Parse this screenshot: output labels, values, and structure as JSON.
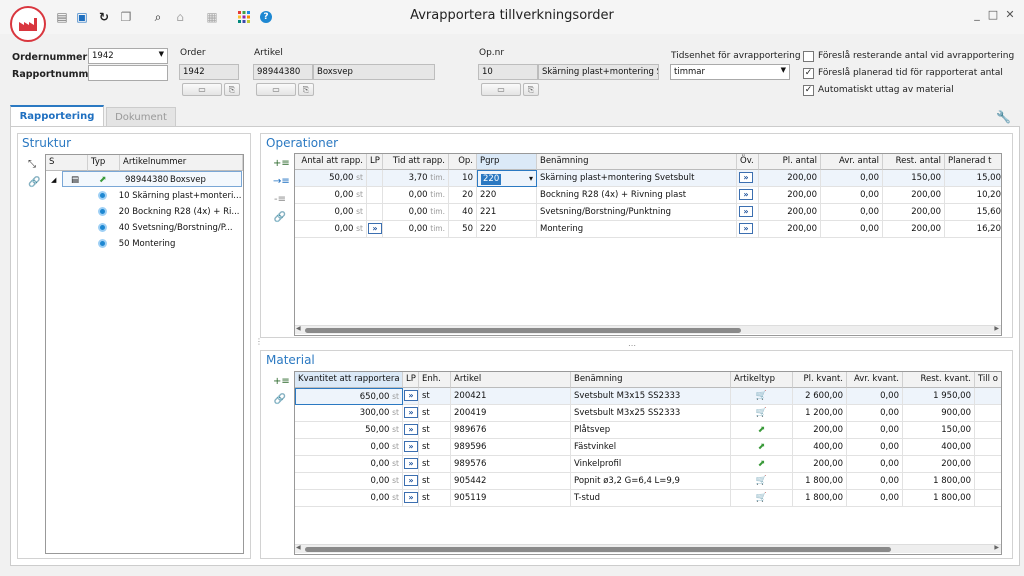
{
  "window": {
    "title": "Avrapportera tillverkningsorder"
  },
  "header": {
    "ordernummer_label": "Ordernummer",
    "ordernummer_value": "1942",
    "rapportnummer_label": "Rapportnummer",
    "rapportnummer_value": "",
    "order_label": "Order",
    "order_value": "1942",
    "artikel_label": "Artikel",
    "artikel_number": "98944380",
    "artikel_name": "Boxsvep",
    "opnr_label": "Op.nr",
    "opnr_value": "10",
    "opnr_name": "Skärning plast+montering Sve",
    "tidsenhet_label": "Tidsenhet för avrapportering",
    "tidsenhet_value": "timmar",
    "checkboxes": [
      {
        "label": "Föreslå resterande antal vid avrapportering",
        "checked": false
      },
      {
        "label": "Föreslå planerad tid för rapporterat antal",
        "checked": true
      },
      {
        "label": "Automatiskt uttag av material",
        "checked": true
      }
    ]
  },
  "tabs": [
    {
      "label": "Rapportering",
      "active": true
    },
    {
      "label": "Dokument",
      "active": false
    }
  ],
  "struktur": {
    "title": "Struktur",
    "columns": [
      "S",
      "Typ",
      "Artikelnummer"
    ],
    "root": {
      "number": "98944380",
      "name": "Boxsvep"
    },
    "ops": [
      "10  Skärning plast+monteri...",
      "20  Bockning R28 (4x) + Ri...",
      "40  Svetsning/Borstning/P...",
      "50  Montering"
    ]
  },
  "operationer": {
    "title": "Operationer",
    "columns": [
      "Antal att rapp.",
      "LP",
      "Tid att rapp.",
      "Op.",
      "Pgrp",
      "Benämning",
      "Öv.",
      "Pl. antal",
      "Avr. antal",
      "Rest. antal",
      "Planerad t"
    ],
    "rows": [
      {
        "antal": "50,00",
        "antal_unit": "st",
        "tid": "3,70",
        "tid_unit": "tim.",
        "op": "10",
        "pgrp": "220",
        "benamning": "Skärning plast+montering Svetsbult",
        "pl": "200,00",
        "avr": "0,00",
        "rest": "150,00",
        "plan": "15,00"
      },
      {
        "antal": "0,00",
        "antal_unit": "st",
        "tid": "0,00",
        "tid_unit": "tim.",
        "op": "20",
        "pgrp": "220",
        "benamning": "Bockning R28 (4x) + Rivning plast",
        "pl": "200,00",
        "avr": "0,00",
        "rest": "200,00",
        "plan": "10,20"
      },
      {
        "antal": "0,00",
        "antal_unit": "st",
        "tid": "0,00",
        "tid_unit": "tim.",
        "op": "40",
        "pgrp": "221",
        "benamning": "Svetsning/Borstning/Punktning",
        "pl": "200,00",
        "avr": "0,00",
        "rest": "200,00",
        "plan": "15,60"
      },
      {
        "antal": "0,00",
        "antal_unit": "st",
        "tid": "0,00",
        "tid_unit": "tim.",
        "op": "50",
        "pgrp": "220",
        "benamning": "Montering",
        "pl": "200,00",
        "avr": "0,00",
        "rest": "200,00",
        "plan": "16,20"
      }
    ]
  },
  "material": {
    "title": "Material",
    "columns": [
      "Kvantitet att rapportera",
      "LP",
      "Enh.",
      "Artikel",
      "Benämning",
      "Artikeltyp",
      "Pl. kvant.",
      "Avr. kvant.",
      "Rest. kvant.",
      "Till o"
    ],
    "rows": [
      {
        "kvant": "650,00",
        "unit": "st",
        "enh": "st",
        "artikel": "200421",
        "benamning": "Svetsbult M3x15 SS2333",
        "typ": "cart",
        "pl": "2 600,00",
        "avr": "0,00",
        "rest": "1 950,00"
      },
      {
        "kvant": "300,00",
        "unit": "st",
        "enh": "st",
        "artikel": "200419",
        "benamning": "Svetsbult M3x25 SS2333",
        "typ": "cart",
        "pl": "1 200,00",
        "avr": "0,00",
        "rest": "900,00"
      },
      {
        "kvant": "50,00",
        "unit": "st",
        "enh": "st",
        "artikel": "989676",
        "benamning": "Plåtsvep",
        "typ": "make",
        "pl": "200,00",
        "avr": "0,00",
        "rest": "150,00"
      },
      {
        "kvant": "0,00",
        "unit": "st",
        "enh": "st",
        "artikel": "989596",
        "benamning": "Fästvinkel",
        "typ": "make",
        "pl": "400,00",
        "avr": "0,00",
        "rest": "400,00"
      },
      {
        "kvant": "0,00",
        "unit": "st",
        "enh": "st",
        "artikel": "989576",
        "benamning": "Vinkelprofil",
        "typ": "make",
        "pl": "200,00",
        "avr": "0,00",
        "rest": "200,00"
      },
      {
        "kvant": "0,00",
        "unit": "st",
        "enh": "st",
        "artikel": "905442",
        "benamning": "Popnit ø3,2 G=6,4 L=9,9",
        "typ": "cart",
        "pl": "1 800,00",
        "avr": "0,00",
        "rest": "1 800,00"
      },
      {
        "kvant": "0,00",
        "unit": "st",
        "enh": "st",
        "artikel": "905119",
        "benamning": "T-stud",
        "typ": "cart",
        "pl": "1 800,00",
        "avr": "0,00",
        "rest": "1 800,00"
      }
    ]
  },
  "units": {
    "st": "st"
  },
  "colors": {
    "accent": "#2b79c2",
    "brand": "#d9363e"
  }
}
